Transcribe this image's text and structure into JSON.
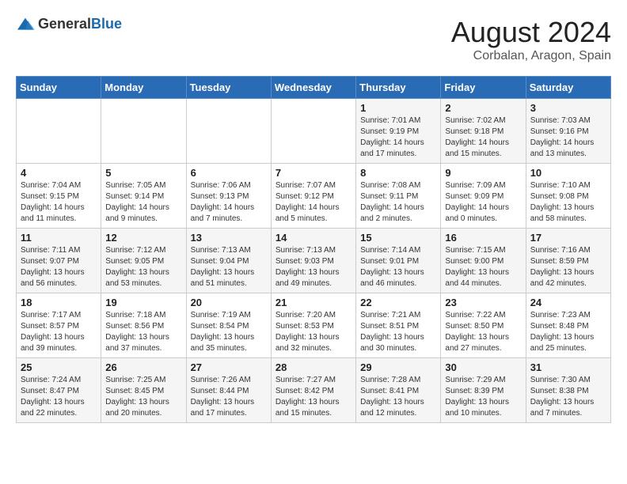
{
  "header": {
    "logo_general": "General",
    "logo_blue": "Blue",
    "month_year": "August 2024",
    "location": "Corbalan, Aragon, Spain"
  },
  "weekdays": [
    "Sunday",
    "Monday",
    "Tuesday",
    "Wednesday",
    "Thursday",
    "Friday",
    "Saturday"
  ],
  "weeks": [
    [
      {
        "day": null
      },
      {
        "day": null
      },
      {
        "day": null
      },
      {
        "day": null
      },
      {
        "day": "1",
        "sunrise": "7:01 AM",
        "sunset": "9:19 PM",
        "daylight": "14 hours and 17 minutes."
      },
      {
        "day": "2",
        "sunrise": "7:02 AM",
        "sunset": "9:18 PM",
        "daylight": "14 hours and 15 minutes."
      },
      {
        "day": "3",
        "sunrise": "7:03 AM",
        "sunset": "9:16 PM",
        "daylight": "14 hours and 13 minutes."
      }
    ],
    [
      {
        "day": "4",
        "sunrise": "7:04 AM",
        "sunset": "9:15 PM",
        "daylight": "14 hours and 11 minutes."
      },
      {
        "day": "5",
        "sunrise": "7:05 AM",
        "sunset": "9:14 PM",
        "daylight": "14 hours and 9 minutes."
      },
      {
        "day": "6",
        "sunrise": "7:06 AM",
        "sunset": "9:13 PM",
        "daylight": "14 hours and 7 minutes."
      },
      {
        "day": "7",
        "sunrise": "7:07 AM",
        "sunset": "9:12 PM",
        "daylight": "14 hours and 5 minutes."
      },
      {
        "day": "8",
        "sunrise": "7:08 AM",
        "sunset": "9:11 PM",
        "daylight": "14 hours and 2 minutes."
      },
      {
        "day": "9",
        "sunrise": "7:09 AM",
        "sunset": "9:09 PM",
        "daylight": "14 hours and 0 minutes."
      },
      {
        "day": "10",
        "sunrise": "7:10 AM",
        "sunset": "9:08 PM",
        "daylight": "13 hours and 58 minutes."
      }
    ],
    [
      {
        "day": "11",
        "sunrise": "7:11 AM",
        "sunset": "9:07 PM",
        "daylight": "13 hours and 56 minutes."
      },
      {
        "day": "12",
        "sunrise": "7:12 AM",
        "sunset": "9:05 PM",
        "daylight": "13 hours and 53 minutes."
      },
      {
        "day": "13",
        "sunrise": "7:13 AM",
        "sunset": "9:04 PM",
        "daylight": "13 hours and 51 minutes."
      },
      {
        "day": "14",
        "sunrise": "7:13 AM",
        "sunset": "9:03 PM",
        "daylight": "13 hours and 49 minutes."
      },
      {
        "day": "15",
        "sunrise": "7:14 AM",
        "sunset": "9:01 PM",
        "daylight": "13 hours and 46 minutes."
      },
      {
        "day": "16",
        "sunrise": "7:15 AM",
        "sunset": "9:00 PM",
        "daylight": "13 hours and 44 minutes."
      },
      {
        "day": "17",
        "sunrise": "7:16 AM",
        "sunset": "8:59 PM",
        "daylight": "13 hours and 42 minutes."
      }
    ],
    [
      {
        "day": "18",
        "sunrise": "7:17 AM",
        "sunset": "8:57 PM",
        "daylight": "13 hours and 39 minutes."
      },
      {
        "day": "19",
        "sunrise": "7:18 AM",
        "sunset": "8:56 PM",
        "daylight": "13 hours and 37 minutes."
      },
      {
        "day": "20",
        "sunrise": "7:19 AM",
        "sunset": "8:54 PM",
        "daylight": "13 hours and 35 minutes."
      },
      {
        "day": "21",
        "sunrise": "7:20 AM",
        "sunset": "8:53 PM",
        "daylight": "13 hours and 32 minutes."
      },
      {
        "day": "22",
        "sunrise": "7:21 AM",
        "sunset": "8:51 PM",
        "daylight": "13 hours and 30 minutes."
      },
      {
        "day": "23",
        "sunrise": "7:22 AM",
        "sunset": "8:50 PM",
        "daylight": "13 hours and 27 minutes."
      },
      {
        "day": "24",
        "sunrise": "7:23 AM",
        "sunset": "8:48 PM",
        "daylight": "13 hours and 25 minutes."
      }
    ],
    [
      {
        "day": "25",
        "sunrise": "7:24 AM",
        "sunset": "8:47 PM",
        "daylight": "13 hours and 22 minutes."
      },
      {
        "day": "26",
        "sunrise": "7:25 AM",
        "sunset": "8:45 PM",
        "daylight": "13 hours and 20 minutes."
      },
      {
        "day": "27",
        "sunrise": "7:26 AM",
        "sunset": "8:44 PM",
        "daylight": "13 hours and 17 minutes."
      },
      {
        "day": "28",
        "sunrise": "7:27 AM",
        "sunset": "8:42 PM",
        "daylight": "13 hours and 15 minutes."
      },
      {
        "day": "29",
        "sunrise": "7:28 AM",
        "sunset": "8:41 PM",
        "daylight": "13 hours and 12 minutes."
      },
      {
        "day": "30",
        "sunrise": "7:29 AM",
        "sunset": "8:39 PM",
        "daylight": "13 hours and 10 minutes."
      },
      {
        "day": "31",
        "sunrise": "7:30 AM",
        "sunset": "8:38 PM",
        "daylight": "13 hours and 7 minutes."
      }
    ]
  ]
}
